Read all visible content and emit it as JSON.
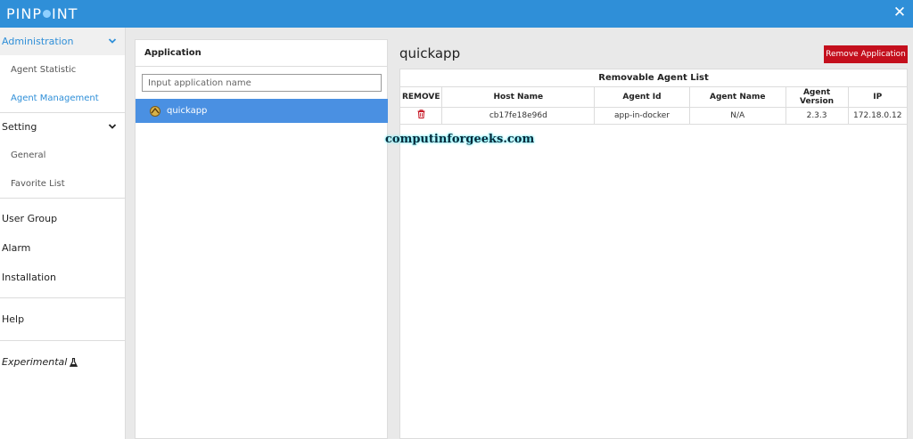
{
  "header": {
    "logo_text_left": "PINP",
    "logo_text_right": "INT"
  },
  "sidebar": {
    "administration": {
      "label": "Administration",
      "items": [
        "Agent Statistic",
        "Agent Management"
      ]
    },
    "setting": {
      "label": "Setting",
      "items": [
        "General",
        "Favorite List"
      ]
    },
    "user_group": "User Group",
    "alarm": "Alarm",
    "installation": "Installation",
    "help": "Help",
    "experimental": "Experimental"
  },
  "application_panel": {
    "title": "Application",
    "search_placeholder": "Input application name",
    "apps": [
      "quickapp"
    ]
  },
  "main": {
    "title": "quickapp",
    "remove_button": "Remove Application",
    "agent_list_title": "Removable Agent List",
    "columns": [
      "REMOVE",
      "Host Name",
      "Agent Id",
      "Agent Name",
      "Agent Version",
      "IP"
    ],
    "rows": [
      {
        "host_name": "cb17fe18e96d",
        "agent_id": "app-in-docker",
        "agent_name": "N/A",
        "agent_version": "2.3.3",
        "ip": "172.18.0.12"
      }
    ]
  },
  "watermark": "computinforgeeks.com",
  "colors": {
    "header": "#2f8fd8",
    "selected_row": "#4a90e2",
    "danger": "#c40f1d",
    "active_link": "#2f8fd8"
  }
}
